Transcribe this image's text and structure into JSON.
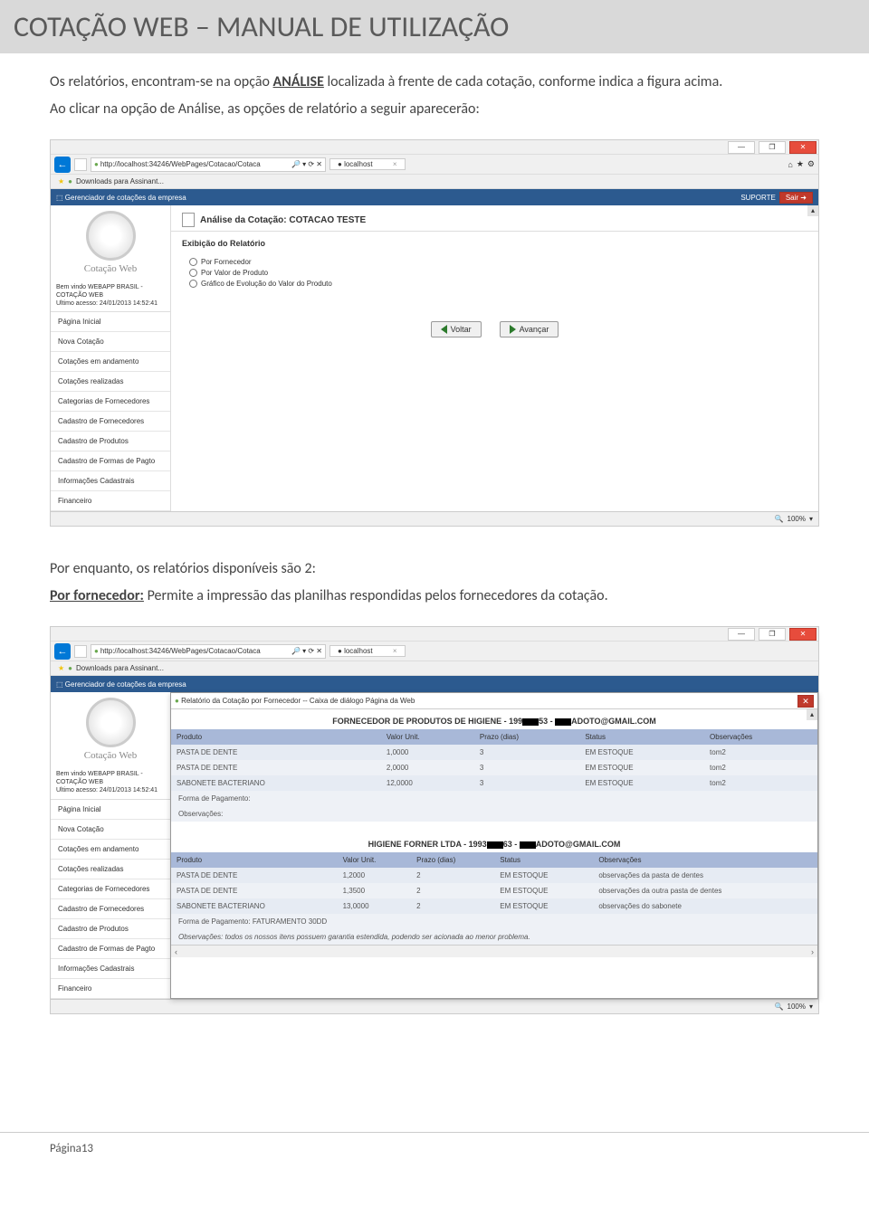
{
  "doc": {
    "title": "COTAÇÃO WEB – MANUAL DE UTILIZAÇÃO",
    "para1_pre": "Os relatórios, encontram-se na opção ",
    "para1_link": "ANÁLISE",
    "para1_post": " localizada à frente de cada cotação, conforme indica a figura acima.",
    "para2": "Ao clicar na opção de Análise, as opções de relatório a seguir aparecerão:",
    "para3": "Por enquanto, os relatórios disponíveis são 2:",
    "para4_label": "Por fornecedor:",
    "para4_rest": " Permite a impressão das planilhas respondidas pelos fornecedores da cotação.",
    "footer": "Página13"
  },
  "shot1": {
    "url": "http://localhost:34246/WebPages/Cotacao/Cotaca",
    "searchHint": "→ ✕",
    "tabLabel": "localhost",
    "favItem": "Downloads para Assinant...",
    "blueLeft": "Gerenciador de cotações da empresa",
    "suporte": "SUPORTE",
    "sair": "Sair ➜",
    "logoText": "Cotação Web",
    "welcome1": "Bem vindo WEBAPP BRASIL - COTAÇÃO WEB",
    "welcome2": "Ultimo acesso: 24/01/2013 14:52:41",
    "nav": [
      "Página Inicial",
      "Nova Cotação",
      "Cotações em andamento",
      "Cotações realizadas",
      "Categorias de Fornecedores",
      "Cadastro de Fornecedores",
      "Cadastro de Produtos",
      "Cadastro de Formas de Pagto",
      "Informações Cadastrais",
      "Financeiro"
    ],
    "panelTitle": "Análise da Cotação: COTACAO TESTE",
    "section": "Exibição do Relatório",
    "opts": [
      "Por Fornecedor",
      "Por Valor de Produto",
      "Gráfico de Evolução do Valor do Produto"
    ],
    "btnBack": "Voltar",
    "btnNext": "Avançar",
    "zoom": "100%"
  },
  "shot2": {
    "url": "http://localhost:34246/WebPages/Cotacao/Cotaca",
    "tabLabel": "localhost",
    "favItem": "Downloads para Assinant...",
    "blueLeft": "Gerenciador de cotações da empresa",
    "logoText": "Cotação Web",
    "welcome1": "Bem vindo WEBAPP BRASIL - COTAÇÃO WEB",
    "welcome2": "Ultimo acesso: 24/01/2013 14:52:41",
    "nav": [
      "Página Inicial",
      "Nova Cotação",
      "Cotações em andamento",
      "Cotações realizadas",
      "Categorias de Fornecedores",
      "Cadastro de Fornecedores",
      "Cadastro de Produtos",
      "Cadastro de Formas de Pagto",
      "Informações Cadastrais",
      "Financeiro"
    ],
    "dialogTitle": "Relatório da Cotação por Fornecedor -- Caixa de diálogo Página da Web",
    "sup1_pre": "FORNECEDOR DE PRODUTOS DE HIGIENE  - 199",
    "sup1_mid": "53  -  ",
    "sup1_post": "ADOTO@GMAIL.COM",
    "cols": [
      "Produto",
      "Valor Unit.",
      "Prazo (dias)",
      "Status",
      "Observações"
    ],
    "sup1_rows": [
      {
        "p": "PASTA DE DENTE",
        "v": "1,0000",
        "d": "3",
        "s": "EM ESTOQUE",
        "o": "tom2"
      },
      {
        "p": "PASTA DE DENTE",
        "v": "2,0000",
        "d": "3",
        "s": "EM ESTOQUE",
        "o": "tom2"
      },
      {
        "p": "SABONETE BACTERIANO",
        "v": "12,0000",
        "d": "3",
        "s": "EM ESTOQUE",
        "o": "tom2"
      }
    ],
    "sup1_pgto": "Forma de Pagamento:",
    "sup1_obs": "Observações:",
    "sup2_pre": "HIGIENE FORNER LTDA  - 1993",
    "sup2_mid": "63  -  ",
    "sup2_post": "ADOTO@GMAIL.COM",
    "sup2_rows": [
      {
        "p": "PASTA DE DENTE",
        "v": "1,2000",
        "d": "2",
        "s": "EM ESTOQUE",
        "o": "observações da pasta de dentes"
      },
      {
        "p": "PASTA DE DENTE",
        "v": "1,3500",
        "d": "2",
        "s": "EM ESTOQUE",
        "o": "observações da outra pasta de dentes"
      },
      {
        "p": "SABONETE BACTERIANO",
        "v": "13,0000",
        "d": "2",
        "s": "EM ESTOQUE",
        "o": "observações do sabonete"
      }
    ],
    "sup2_pgto": "Forma de Pagamento: FATURAMENTO 30DD",
    "sup2_obs": "Observações: todos os nossos itens possuem garantia estendida, podendo ser acionada ao menor problema.",
    "zoom": "100%"
  }
}
